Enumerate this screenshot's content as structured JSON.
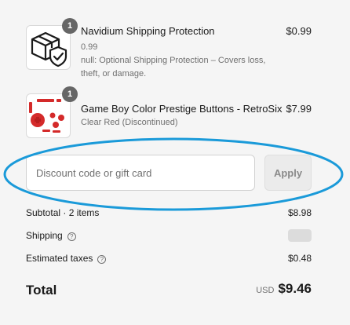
{
  "items": [
    {
      "quantity": "1",
      "title": "Navidium Shipping Protection",
      "variant": "0.99",
      "note_line1": "null: Optional Shipping Protection – Covers loss,",
      "note_line2": "theft, or damage.",
      "price": "$0.99",
      "icon": "package-shield-icon"
    },
    {
      "quantity": "1",
      "title": "Game Boy Color Prestige Buttons - RetroSix",
      "variant": "Clear Red (Discontinued)",
      "price": "$7.99",
      "icon": "red-buttons-image"
    }
  ],
  "discount": {
    "placeholder": "Discount code or gift card",
    "value": "",
    "apply_label": "Apply"
  },
  "summary": {
    "subtotal_label": "Subtotal · 2 items",
    "subtotal_value": "$8.98",
    "shipping_label": "Shipping",
    "taxes_label": "Estimated taxes",
    "taxes_value": "$0.48",
    "help_glyph": "?"
  },
  "total": {
    "label": "Total",
    "currency": "USD",
    "amount": "$9.46"
  },
  "colors": {
    "background": "#f5f5f5",
    "highlight": "#1a9ad9",
    "product_red": "#d42a2a"
  }
}
